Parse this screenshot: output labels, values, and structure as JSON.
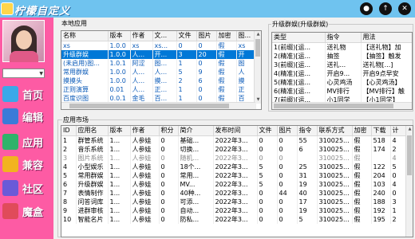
{
  "window": {
    "title": "柠檬自定义"
  },
  "sidebar": {
    "user_name": "",
    "items": [
      {
        "label": "首页",
        "icon": "home-icon",
        "color": "#3aa8e8"
      },
      {
        "label": "编辑",
        "icon": "folder-icon",
        "color": "#3b7bd8"
      },
      {
        "label": "应用",
        "icon": "apps-icon",
        "color": "#2fb36a"
      },
      {
        "label": "兼容",
        "icon": "pencil-icon",
        "color": "#f2b31f"
      },
      {
        "label": "社区",
        "icon": "community-icon",
        "color": "#6a5ad8"
      },
      {
        "label": "魔盒",
        "icon": "magic-box-icon",
        "color": "#e04b5a"
      }
    ]
  },
  "local_apps": {
    "title": "本地应用",
    "columns": [
      "名称",
      "版本",
      "作者",
      "文...",
      "文件",
      "图片",
      "加密",
      "图..."
    ],
    "rows": [
      [
        "xs",
        "1.0.0",
        "xs",
        "xs...",
        "0",
        "0",
        "假",
        "xs"
      ],
      [
        "升级群娱",
        "1.0.0",
        "人...",
        "开...",
        "3",
        "20",
        "假",
        "开"
      ],
      [
        "(未启用)图...",
        "1.0.1",
        "阿涩",
        "图...",
        "1",
        "0",
        "假",
        "图"
      ],
      [
        "常用群娱",
        "1.0.0",
        "人...",
        "人...",
        "5",
        "9",
        "假",
        "人"
      ],
      [
        "摸摸头",
        "1.0.0",
        "人...",
        "摸...",
        "2",
        "6",
        "假",
        "摸"
      ],
      [
        "正则演算",
        "0.01",
        "人...",
        "正...",
        "1",
        "0",
        "假",
        "正"
      ],
      [
        "百度识图",
        "0.0.1",
        "金毛",
        "百...",
        "1",
        "0",
        "假",
        "百"
      ],
      [
        "当前群时间",
        "1.0.0",
        "人...",
        "当...",
        "1",
        "0",
        "假",
        "当"
      ]
    ],
    "selected_row": 1
  },
  "upgrade": {
    "title": "升级群娱(升级群娱)",
    "columns": [
      "类型",
      "指令",
      "用法"
    ],
    "rows": [
      [
        "1(前缀)[运...",
        "送礼物",
        "【送礼物】加"
      ],
      [
        "2(精准)[运...",
        "抽签",
        "【抽签】触发"
      ],
      [
        "3(前缀)[运...",
        "送礼...",
        "送礼物[...]"
      ],
      [
        "4(精准)[运...",
        "开启9...",
        "开启9点早安"
      ],
      [
        "5(精准)[运...",
        "心灵鸡汤",
        "【心灵鸡汤】"
      ],
      [
        "6(精准)[运...",
        "MV排行",
        "【MV排行】触"
      ],
      [
        "7(前缀)[运...",
        "小1同学",
        "【小1同学】"
      ]
    ]
  },
  "market": {
    "title": "应用市场",
    "columns": [
      "ID",
      "应用名",
      "版本",
      "作者",
      "积分",
      "简介",
      "发布时间",
      "文件",
      "图片",
      "指令",
      "联系方式",
      "加密",
      "下载",
      "计"
    ],
    "rows": [
      [
        "1",
        "群管系统",
        "1...",
        "人参娃",
        "0",
        "基础...",
        "2022年3...",
        "0",
        "0",
        "55",
        "310025...",
        "假",
        "518",
        "4"
      ],
      [
        "2",
        "音乐系统",
        "1...",
        "人参娃",
        "0",
        "切换...",
        "2022年3...",
        "0",
        "0",
        "6",
        "310025...",
        "假",
        "174",
        "2"
      ],
      [
        "3",
        "图片系统",
        "1...",
        "人参娃",
        "0",
        "随机...",
        "2022年3...",
        "0",
        "0",
        "",
        "310025...",
        "假",
        "",
        "4"
      ],
      [
        "4",
        "小型娱乐",
        "1...",
        "人参娃",
        "0",
        "18个...",
        "2022年3...",
        "5",
        "0",
        "25",
        "310025...",
        "假",
        "122",
        "5"
      ],
      [
        "5",
        "常用群娱",
        "1...",
        "人参娃",
        "0",
        "常用...",
        "2022年3...",
        "5",
        "0",
        "31",
        "310025...",
        "假",
        "204",
        "0"
      ],
      [
        "6",
        "升级群娱",
        "1...",
        "人参娃",
        "0",
        "MV...",
        "2022年3...",
        "5",
        "0",
        "19",
        "310025...",
        "假",
        "103",
        "4"
      ],
      [
        "7",
        "表情制作",
        "1...",
        "人参娃",
        "0",
        "40种...",
        "2022年3...",
        "0",
        "44",
        "40",
        "310025...",
        "假",
        "240",
        "0"
      ],
      [
        "8",
        "问答词库",
        "1...",
        "人参娃",
        "0",
        "可添...",
        "2022年3...",
        "0",
        "0",
        "17",
        "310025...",
        "假",
        "188",
        "3"
      ],
      [
        "9",
        "进群审核",
        "1...",
        "人参娃",
        "0",
        "自动...",
        "2022年3...",
        "0",
        "0",
        "19",
        "310025...",
        "假",
        "192",
        "1"
      ],
      [
        "10",
        "智能名片",
        "1...",
        "人参娃",
        "0",
        "防私...",
        "2022年3...",
        "0",
        "0",
        "5",
        "310025...",
        "假",
        "195",
        "2"
      ]
    ],
    "dim_rows": [
      2
    ]
  }
}
